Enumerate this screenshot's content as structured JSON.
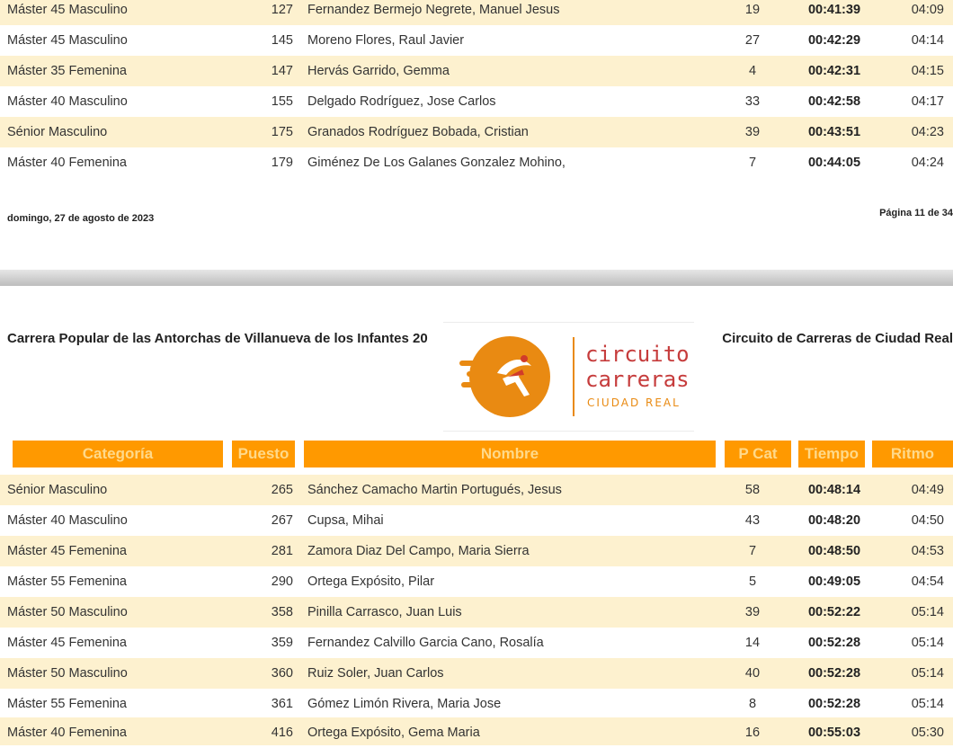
{
  "page_prev": {
    "rows": [
      {
        "categoria": "Máster 45 Masculino",
        "puesto": "127",
        "nombre": "Fernandez Bermejo Negrete, Manuel Jesus",
        "pcat": "19",
        "tiempo": "00:41:39",
        "ritmo": "04:09"
      },
      {
        "categoria": "Máster 45 Masculino",
        "puesto": "145",
        "nombre": "Moreno Flores, Raul Javier",
        "pcat": "27",
        "tiempo": "00:42:29",
        "ritmo": "04:14"
      },
      {
        "categoria": "Máster 35 Femenina",
        "puesto": "147",
        "nombre": "Hervás Garrido, Gemma",
        "pcat": "4",
        "tiempo": "00:42:31",
        "ritmo": "04:15"
      },
      {
        "categoria": "Máster 40 Masculino",
        "puesto": "155",
        "nombre": "Delgado Rodríguez, Jose Carlos",
        "pcat": "33",
        "tiempo": "00:42:58",
        "ritmo": "04:17"
      },
      {
        "categoria": "Sénior Masculino",
        "puesto": "175",
        "nombre": "Granados Rodríguez Bobada, Cristian",
        "pcat": "39",
        "tiempo": "00:43:51",
        "ritmo": "04:23"
      },
      {
        "categoria": "Máster 40 Femenina",
        "puesto": "179",
        "nombre": "Giménez De Los Galanes Gonzalez Mohino,",
        "pcat": "7",
        "tiempo": "00:44:05",
        "ritmo": "04:24"
      }
    ],
    "footer_date": "domingo, 27 de agosto de 2023",
    "footer_page": "Página 11 de 34"
  },
  "page_next": {
    "header_left": "Carrera Popular de las Antorchas de Villanueva de los Infantes 20",
    "header_right": "Circuito de Carreras de Ciudad Real",
    "logo": {
      "line1": "circuito",
      "line2": "carreras",
      "line3": "CIUDAD REAL",
      "color": "#e98a12",
      "text_color": "#c63c3c",
      "icon": "runner-ball-logo-icon"
    },
    "columns": {
      "categoria": "Categoría",
      "puesto": "Puesto",
      "nombre": "Nombre",
      "pcat": "P Cat",
      "tiempo": "Tiempo",
      "ritmo": "Ritmo"
    },
    "rows": [
      {
        "categoria": "Sénior Masculino",
        "puesto": "265",
        "nombre": "Sánchez Camacho Martin Portugués, Jesus",
        "pcat": "58",
        "tiempo": "00:48:14",
        "ritmo": "04:49"
      },
      {
        "categoria": "Máster 40 Masculino",
        "puesto": "267",
        "nombre": "Cupsa, Mihai",
        "pcat": "43",
        "tiempo": "00:48:20",
        "ritmo": "04:50"
      },
      {
        "categoria": "Máster 45 Femenina",
        "puesto": "281",
        "nombre": "Zamora Diaz Del Campo, Maria Sierra",
        "pcat": "7",
        "tiempo": "00:48:50",
        "ritmo": "04:53"
      },
      {
        "categoria": "Máster 55 Femenina",
        "puesto": "290",
        "nombre": "Ortega Expósito, Pilar",
        "pcat": "5",
        "tiempo": "00:49:05",
        "ritmo": "04:54"
      },
      {
        "categoria": "Máster 50 Masculino",
        "puesto": "358",
        "nombre": "Pinilla Carrasco, Juan Luis",
        "pcat": "39",
        "tiempo": "00:52:22",
        "ritmo": "05:14"
      },
      {
        "categoria": "Máster 45 Femenina",
        "puesto": "359",
        "nombre": "Fernandez Calvillo Garcia Cano, Rosalía",
        "pcat": "14",
        "tiempo": "00:52:28",
        "ritmo": "05:14"
      },
      {
        "categoria": "Máster 50 Masculino",
        "puesto": "360",
        "nombre": "Ruiz Soler, Juan Carlos",
        "pcat": "40",
        "tiempo": "00:52:28",
        "ritmo": "05:14"
      },
      {
        "categoria": "Máster 55 Femenina",
        "puesto": "361",
        "nombre": "Gómez Limón Rivera, Maria Jose",
        "pcat": "8",
        "tiempo": "00:52:28",
        "ritmo": "05:14"
      },
      {
        "categoria": "Máster 40 Femenina",
        "puesto": "416",
        "nombre": "Ortega Expósito, Gema Maria",
        "pcat": "16",
        "tiempo": "00:55:03",
        "ritmo": "05:30"
      }
    ]
  }
}
